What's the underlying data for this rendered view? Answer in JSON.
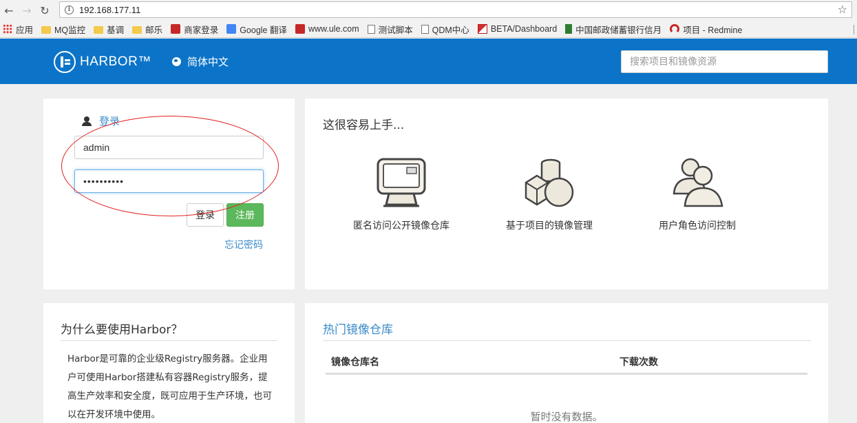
{
  "browser": {
    "back_glyph": "←",
    "forward_glyph": "→",
    "reload_glyph": "↻",
    "info_glyph": "i",
    "url": "192.168.177.11",
    "star_glyph": "☆",
    "bookmarks": [
      {
        "label": "应用",
        "icon": "apps-icon"
      },
      {
        "label": "MQ监控",
        "icon": "folder-icon"
      },
      {
        "label": "基调",
        "icon": "folder-icon"
      },
      {
        "label": "邮乐",
        "icon": "folder-icon"
      },
      {
        "label": "商家登录",
        "icon": "site-icon"
      },
      {
        "label": "Google 翻译",
        "icon": "google-translate-icon"
      },
      {
        "label": "www.ule.com",
        "icon": "site-icon"
      },
      {
        "label": "测试脚本",
        "icon": "page-icon"
      },
      {
        "label": "QDM中心",
        "icon": "page-icon"
      },
      {
        "label": "BETA/Dashboard",
        "icon": "beta-icon"
      },
      {
        "label": "中国邮政储蓄银行信月",
        "icon": "bank-icon"
      },
      {
        "label": "项目 - Redmine",
        "icon": "redmine-icon"
      }
    ]
  },
  "header": {
    "logo_text": "HARBOR™",
    "language": "简体中文",
    "search_placeholder": "搜索项目和镜像资源"
  },
  "login": {
    "title": "登录",
    "username_value": "admin",
    "password_value": "••••••••••",
    "login_button": "登录",
    "register_button": "注册",
    "forgot_link": "忘记密码"
  },
  "features": {
    "title": "这很容易上手...",
    "items": [
      {
        "label": "匿名访问公开镜像仓库",
        "icon": "monitor-icon"
      },
      {
        "label": "基于项目的镜像管理",
        "icon": "shapes-icon"
      },
      {
        "label": "用户角色访问控制",
        "icon": "users-icon"
      }
    ]
  },
  "why": {
    "title": "为什么要使用Harbor？",
    "body": "Harbor是可靠的企业级Registry服务器。企业用户可使用Harbor搭建私有容器Registry服务，提高生产效率和安全度，既可应用于生产环境，也可以在开发环境中使用。"
  },
  "top_repos": {
    "title": "热门镜像仓库",
    "columns": [
      "镜像仓库名",
      "下载次数"
    ],
    "empty_text": "暂时没有数据。"
  },
  "colors": {
    "header_bg": "#0b74c8",
    "link": "#3a8bc8",
    "register_bg": "#5cb85c",
    "annotation_ellipse": "#e02020"
  }
}
